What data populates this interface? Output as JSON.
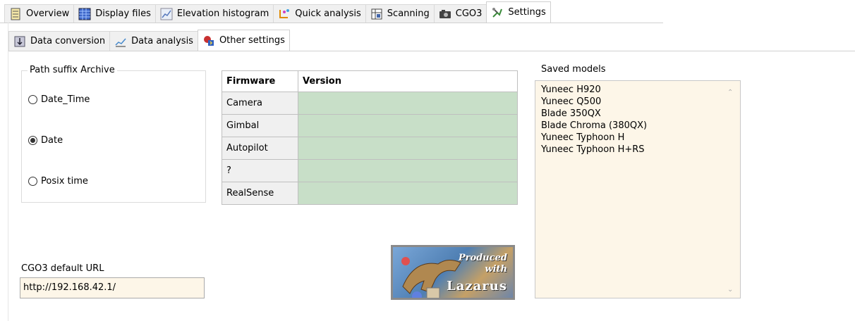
{
  "tabs": [
    {
      "label": "Overview",
      "icon": "overview-icon",
      "active": false
    },
    {
      "label": "Display files",
      "icon": "display-files-icon",
      "active": false
    },
    {
      "label": "Elevation histogram",
      "icon": "histogram-icon",
      "active": false
    },
    {
      "label": "Quick analysis",
      "icon": "quick-analysis-icon",
      "active": false
    },
    {
      "label": "Scanning",
      "icon": "scanning-icon",
      "active": false
    },
    {
      "label": "CGO3",
      "icon": "camera-icon",
      "active": false
    },
    {
      "label": "Settings",
      "icon": "settings-icon",
      "active": true
    }
  ],
  "subtabs": [
    {
      "label": "Data conversion",
      "icon": "data-conversion-icon",
      "active": false
    },
    {
      "label": "Data analysis",
      "icon": "data-analysis-icon",
      "active": false
    },
    {
      "label": "Other settings",
      "icon": "other-settings-icon",
      "active": true
    }
  ],
  "path_suffix": {
    "title": "Path suffix Archive",
    "options": [
      "Date_Time",
      "Date",
      "Posix time"
    ],
    "selected": "Date"
  },
  "firmware_table": {
    "headers": [
      "Firmware",
      "Version"
    ],
    "rows": [
      {
        "label": "Camera",
        "value": ""
      },
      {
        "label": "Gimbal",
        "value": ""
      },
      {
        "label": "Autopilot",
        "value": ""
      },
      {
        "label": "?",
        "value": ""
      },
      {
        "label": "RealSense",
        "value": ""
      }
    ]
  },
  "saved_models": {
    "title": "Saved models",
    "items": [
      "Yuneec H920",
      "Yuneec Q500",
      "Blade 350QX",
      "Blade Chroma (380QX)",
      "Yuneec Typhoon H",
      "Yuneec Typhoon H+RS"
    ]
  },
  "cgo3_url": {
    "label": "CGO3 default URL",
    "value": "http://192.168.42.1/"
  },
  "logo": {
    "line1": "Produced",
    "line2": "with",
    "line3": "Lazarus"
  },
  "colors": {
    "version_cell": "#c8dfc8",
    "input_bg": "#fdf6e8"
  }
}
